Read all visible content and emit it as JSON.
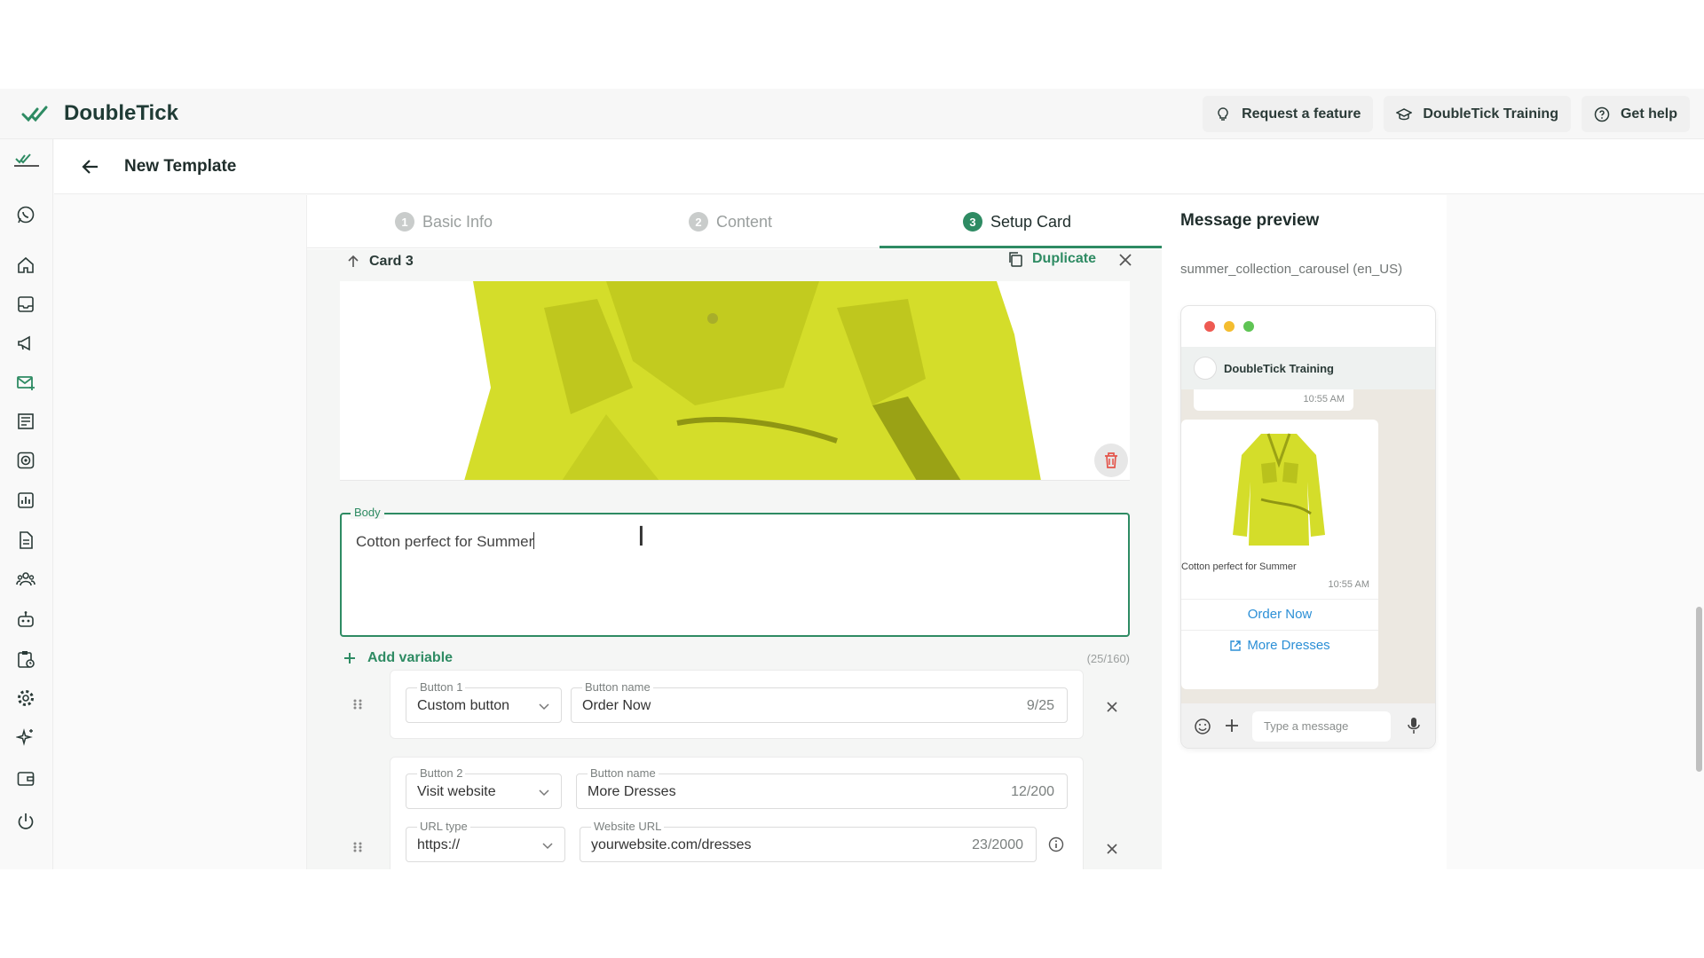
{
  "app": {
    "name": "DoubleTick"
  },
  "header": {
    "actions": [
      {
        "label": "Request a feature",
        "icon": "lightbulb-icon"
      },
      {
        "label": "DoubleTick Training",
        "icon": "graduation-cap-icon"
      },
      {
        "label": "Get help",
        "icon": "help-circle-icon"
      }
    ]
  },
  "sidebar": {
    "items": [
      {
        "icon": "whatsapp-icon"
      },
      {
        "icon": "home-icon"
      },
      {
        "icon": "inbox-icon"
      },
      {
        "icon": "megaphone-icon"
      },
      {
        "icon": "mail-add-icon"
      },
      {
        "icon": "catalog-icon"
      },
      {
        "icon": "target-icon"
      },
      {
        "icon": "bar-chart-icon"
      },
      {
        "icon": "document-icon"
      },
      {
        "icon": "team-icon"
      },
      {
        "icon": "bot-icon"
      },
      {
        "icon": "clipboard-icon"
      },
      {
        "icon": "gear-icon"
      },
      {
        "icon": "sparkle-icon"
      },
      {
        "icon": "wallet-icon"
      },
      {
        "icon": "power-icon"
      }
    ]
  },
  "page": {
    "title": "New Template"
  },
  "steps": [
    {
      "num": "1",
      "label": "Basic Info"
    },
    {
      "num": "2",
      "label": "Content"
    },
    {
      "num": "3",
      "label": "Setup Card",
      "active": true
    }
  ],
  "card": {
    "title": "Card 3",
    "duplicate_label": "Duplicate",
    "body_label": "Body",
    "body_value": "Cotton perfect for Summer",
    "add_variable_label": "Add variable",
    "counter": "(25/160)",
    "buttons": [
      {
        "type_label": "Button 1",
        "type_value": "Custom button",
        "name_label": "Button name",
        "name_value": "Order Now",
        "name_count": "9/25"
      },
      {
        "type_label": "Button 2",
        "type_value": "Visit website",
        "name_label": "Button name",
        "name_value": "More Dresses",
        "name_count": "12/200",
        "url_type_label": "URL type",
        "url_type_value": "https://",
        "url_label": "Website URL",
        "url_value": "yourwebsite.com/dresses",
        "url_count": "23/2000"
      }
    ]
  },
  "preview": {
    "title": "Message preview",
    "template_name": "summer_collection_carousel (en_US)",
    "chat_name": "DoubleTick Training",
    "time_top": "10:55 AM",
    "caption": "Cotton perfect for Summer",
    "time": "10:55 AM",
    "buttons": [
      "Order Now",
      "More Dresses"
    ],
    "input_placeholder": "Type a message",
    "dot_colors": [
      "#ee5a52",
      "#f4bd2f",
      "#5fc454"
    ]
  },
  "colors": {
    "accent": "#2e8b63",
    "link": "#2b8fd6",
    "jacket": "#d4dd2a"
  }
}
